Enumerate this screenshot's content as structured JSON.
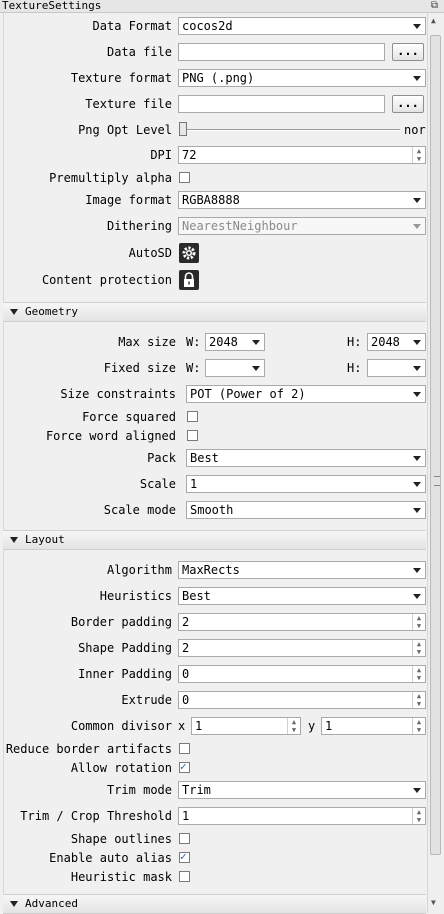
{
  "window": {
    "title": "TextureSettings",
    "float_icon": "restore-icon"
  },
  "data_format": {
    "label": "Data Format",
    "value": "cocos2d"
  },
  "data_file": {
    "label": "Data file",
    "value": "",
    "button": "..."
  },
  "texture_format": {
    "label": "Texture format",
    "value": "PNG (.png)"
  },
  "texture_file": {
    "label": "Texture file",
    "value": "",
    "button": "..."
  },
  "png_opt": {
    "label": "Png Opt Level",
    "value_text": "nor"
  },
  "dpi": {
    "label": "DPI",
    "value": "72"
  },
  "premultiply": {
    "label": "Premultiply alpha",
    "checked": false
  },
  "image_format": {
    "label": "Image format",
    "value": "RGBA8888"
  },
  "dithering": {
    "label": "Dithering",
    "value": "NearestNeighbour"
  },
  "autosd": {
    "label": "AutoSD"
  },
  "content_protection": {
    "label": "Content protection"
  },
  "geometry": {
    "title": "Geometry",
    "max_size": {
      "label": "Max size",
      "w_label": "W:",
      "w_value": "2048",
      "h_label": "H:",
      "h_value": "2048"
    },
    "fixed_size": {
      "label": "Fixed size",
      "w_label": "W:",
      "w_value": "",
      "h_label": "H:",
      "h_value": ""
    },
    "size_constraints": {
      "label": "Size constraints",
      "value": "POT (Power of 2)"
    },
    "force_squared": {
      "label": "Force squared",
      "checked": false
    },
    "force_word_aligned": {
      "label": "Force word aligned",
      "checked": false
    },
    "pack": {
      "label": "Pack",
      "value": "Best"
    },
    "scale": {
      "label": "Scale",
      "value": "1"
    },
    "scale_mode": {
      "label": "Scale mode",
      "value": "Smooth"
    }
  },
  "layout": {
    "title": "Layout",
    "algorithm": {
      "label": "Algorithm",
      "value": "MaxRects"
    },
    "heuristics": {
      "label": "Heuristics",
      "value": "Best"
    },
    "border_padding": {
      "label": "Border padding",
      "value": "2"
    },
    "shape_padding": {
      "label": "Shape Padding",
      "value": "2"
    },
    "inner_padding": {
      "label": "Inner Padding",
      "value": "0"
    },
    "extrude": {
      "label": "Extrude",
      "value": "0"
    },
    "common_divisor": {
      "label": "Common divisor",
      "x_label": "x",
      "x_value": "1",
      "y_label": "y",
      "y_value": "1"
    },
    "reduce_border": {
      "label": "Reduce border artifacts",
      "checked": false
    },
    "allow_rotation": {
      "label": "Allow rotation",
      "checked": true
    },
    "trim_mode": {
      "label": "Trim mode",
      "value": "Trim"
    },
    "trim_threshold": {
      "label": "Trim / Crop Threshold",
      "value": "1"
    },
    "shape_outlines": {
      "label": "Shape outlines",
      "checked": false
    },
    "auto_alias": {
      "label": "Enable auto alias",
      "checked": true
    },
    "heuristic_mask": {
      "label": "Heuristic mask",
      "checked": false
    }
  },
  "advanced": {
    "title": "Advanced"
  },
  "colors": {
    "section_bg": "#e3e3e3",
    "check_mark": "#2b5da8",
    "field_border": "#a9a9a9"
  }
}
